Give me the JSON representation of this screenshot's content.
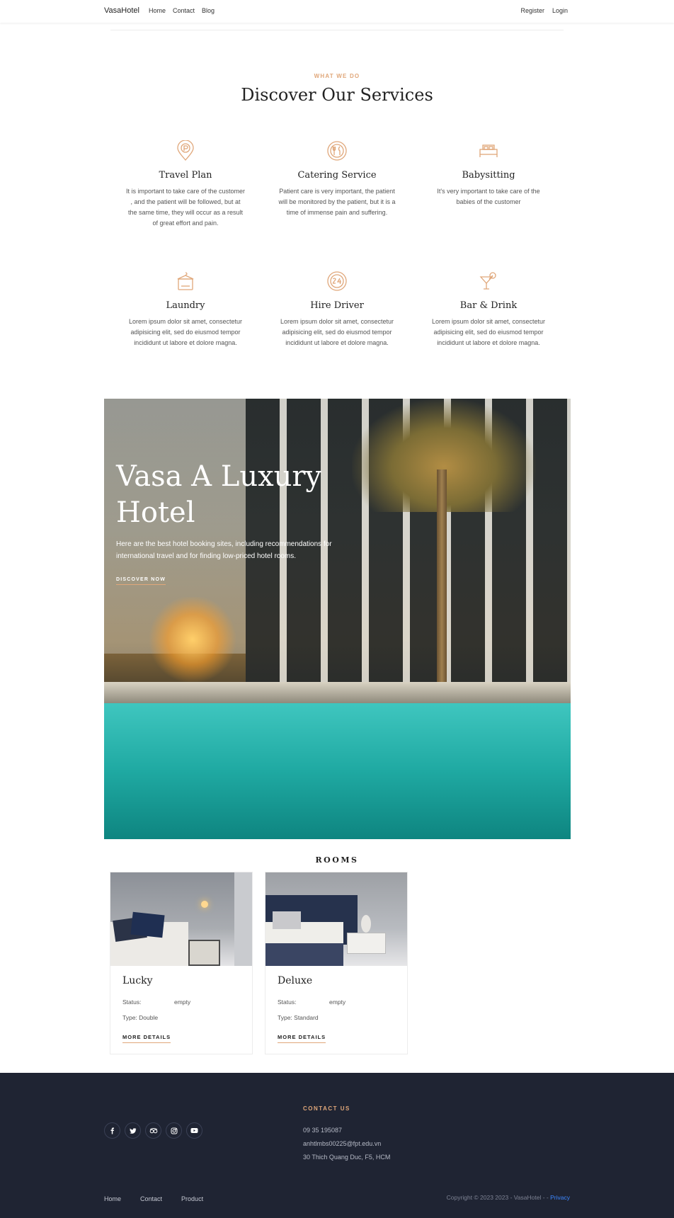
{
  "nav": {
    "brand": "VasaHotel",
    "links": [
      "Home",
      "Contact",
      "Blog"
    ],
    "right": [
      "Register",
      "Login"
    ]
  },
  "services": {
    "eyebrow": "WHAT WE DO",
    "title": "Discover Our Services",
    "items": [
      {
        "icon": "parking-pin-icon",
        "name": "Travel Plan",
        "desc": "It is important to take care of the customer , and the patient will be followed, but at the same time, they will occur as a result of great effort and pain."
      },
      {
        "icon": "dining-icon",
        "name": "Catering Service",
        "desc": "Patient care is very important, the patient will be monitored by the patient, but it is a time of immense pain and suffering."
      },
      {
        "icon": "bed-icon",
        "name": "Babysitting",
        "desc": "It's very important to take care of the babies of the customer"
      },
      {
        "icon": "laundry-icon",
        "name": "Laundry",
        "desc": "Lorem ipsum dolor sit amet, consectetur adipisicing elit, sed do eiusmod tempor incididunt ut labore et dolore magna."
      },
      {
        "icon": "24-hours-icon",
        "name": "Hire Driver",
        "desc": "Lorem ipsum dolor sit amet, consectetur adipisicing elit, sed do eiusmod tempor incididunt ut labore et dolore magna."
      },
      {
        "icon": "cocktail-icon",
        "name": "Bar & Drink",
        "desc": "Lorem ipsum dolor sit amet, consectetur adipisicing elit, sed do eiusmod tempor incididunt ut labore et dolore magna."
      }
    ]
  },
  "hero": {
    "title": "Vasa A Luxury Hotel",
    "desc": "Here are the best hotel booking sites, including recommendations for international travel and for finding low-priced hotel rooms.",
    "button": "DISCOVER NOW"
  },
  "rooms": {
    "title": "ROOMS",
    "items": [
      {
        "name": "Lucky",
        "status_label": "Status:",
        "status": "empty",
        "type": "Type: Double",
        "more": "MORE DETAILS"
      },
      {
        "name": "Deluxe",
        "status_label": "Status:",
        "status": "empty",
        "type": "Type: Standard",
        "more": "MORE DETAILS"
      }
    ]
  },
  "footer": {
    "social": [
      "facebook-icon",
      "twitter-icon",
      "tripadvisor-icon",
      "instagram-icon",
      "youtube-icon"
    ],
    "contact_heading": "CONTACT US",
    "phone": "09 35 195087",
    "email": "anhtlmbs00225@fpt.edu.vn",
    "address": "30 Thich Quang Duc, F5, HCM",
    "nav": [
      "Home",
      "Contact",
      "Product"
    ],
    "copyright": "Copyright © 2023 2023 - VasaHotel - -",
    "privacy": "Privacy"
  },
  "colors": {
    "accent": "#e0a77a",
    "footer_bg": "#1f2433",
    "link": "#3d87ff"
  }
}
